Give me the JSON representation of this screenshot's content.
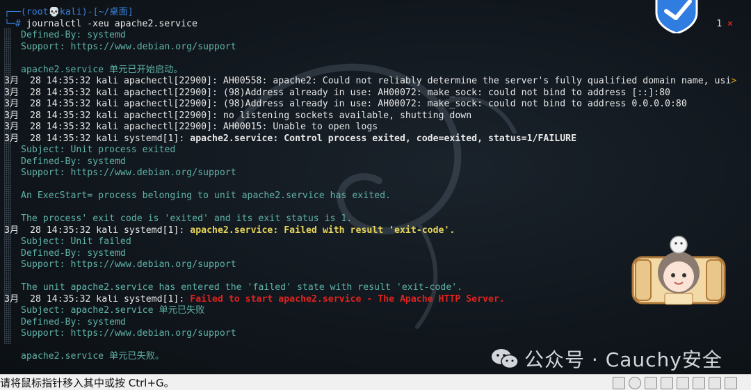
{
  "prompt": {
    "top": "┌──(root💀kali)-[~/桌面]",
    "bottom_mark": "└─#",
    "command": " journalctl -xeu apache2.service"
  },
  "pager": {
    "page": "1",
    "close_glyph": "×"
  },
  "overflow_glyph": ">",
  "log": [
    {
      "indent": true,
      "cls": "cyan",
      "text": "Defined-By: systemd"
    },
    {
      "indent": true,
      "cls": "cyan",
      "text": "Support: https://www.debian.org/support"
    },
    {
      "indent": true,
      "cls": "cyan",
      "text": ""
    },
    {
      "indent": true,
      "cls": "cyan",
      "text": "apache2.service 单元已开始启动。"
    },
    {
      "indent": false,
      "cls": "white",
      "text": "3月  28 14:35:32 kali apachectl[22900]: AH00558: apache2: Could not reliably determine the server's fully qualified domain name, usi",
      "overflow": true
    },
    {
      "indent": false,
      "cls": "white",
      "text": "3月  28 14:35:32 kali apachectl[22900]: (98)Address already in use: AH00072: make_sock: could not bind to address [::]:80"
    },
    {
      "indent": false,
      "cls": "white",
      "text": "3月  28 14:35:32 kali apachectl[22900]: (98)Address already in use: AH00072: make_sock: could not bind to address 0.0.0.0:80"
    },
    {
      "indent": false,
      "cls": "white",
      "text": "3月  28 14:35:32 kali apachectl[22900]: no listening sockets available, shutting down"
    },
    {
      "indent": false,
      "cls": "white",
      "text": "3月  28 14:35:32 kali apachectl[22900]: AH00015: Unable to open logs"
    },
    {
      "indent": false,
      "cls": "white",
      "text": "3月  28 14:35:32 kali systemd[1]: ",
      "highlight": "apache2.service: Control process exited, code=exited, status=1/FAILURE",
      "hcls": "white bold"
    },
    {
      "indent": true,
      "cls": "cyan",
      "text": "Subject: Unit process exited"
    },
    {
      "indent": true,
      "cls": "cyan",
      "text": "Defined-By: systemd"
    },
    {
      "indent": true,
      "cls": "cyan",
      "text": "Support: https://www.debian.org/support"
    },
    {
      "indent": true,
      "cls": "cyan",
      "text": ""
    },
    {
      "indent": true,
      "cls": "cyan",
      "text": "An ExecStart= process belonging to unit apache2.service has exited."
    },
    {
      "indent": true,
      "cls": "cyan",
      "text": ""
    },
    {
      "indent": true,
      "cls": "cyan",
      "text": "The process' exit code is 'exited' and its exit status is 1."
    },
    {
      "indent": false,
      "cls": "white",
      "text": "3月  28 14:35:32 kali systemd[1]: ",
      "highlight": "apache2.service: Failed with result 'exit-code'.",
      "hcls": "yellow"
    },
    {
      "indent": true,
      "cls": "cyan",
      "text": "Subject: Unit failed"
    },
    {
      "indent": true,
      "cls": "cyan",
      "text": "Defined-By: systemd"
    },
    {
      "indent": true,
      "cls": "cyan",
      "text": "Support: https://www.debian.org/support"
    },
    {
      "indent": true,
      "cls": "cyan",
      "text": ""
    },
    {
      "indent": true,
      "cls": "cyan",
      "text": "The unit apache2.service has entered the 'failed' state with result 'exit-code'."
    },
    {
      "indent": false,
      "cls": "white",
      "text": "3月  28 14:35:32 kali systemd[1]: ",
      "highlight": "Failed to start apache2.service - The Apache HTTP Server.",
      "hcls": "red"
    },
    {
      "indent": true,
      "cls": "cyan",
      "text": "Subject: apache2.service 单元已失败"
    },
    {
      "indent": true,
      "cls": "cyan",
      "text": "Defined-By: systemd"
    },
    {
      "indent": true,
      "cls": "cyan",
      "text": "Support: https://www.debian.org/support"
    },
    {
      "indent": true,
      "cls": "cyan",
      "text": ""
    },
    {
      "indent": true,
      "cls": "cyan",
      "text": "apache2.service 单元已失败。"
    }
  ],
  "watermark": "公众号 · Cauchy安全",
  "statusbar": {
    "message": "请将鼠标指针移入其中或按 Ctrl+G。"
  },
  "colors": {
    "bg": "#10161c",
    "cyan_text": "#5fb3a8",
    "prompt_blue": "#3a7fd8",
    "error_red": "#e0221e",
    "warn_yellow": "#e6d55a"
  }
}
